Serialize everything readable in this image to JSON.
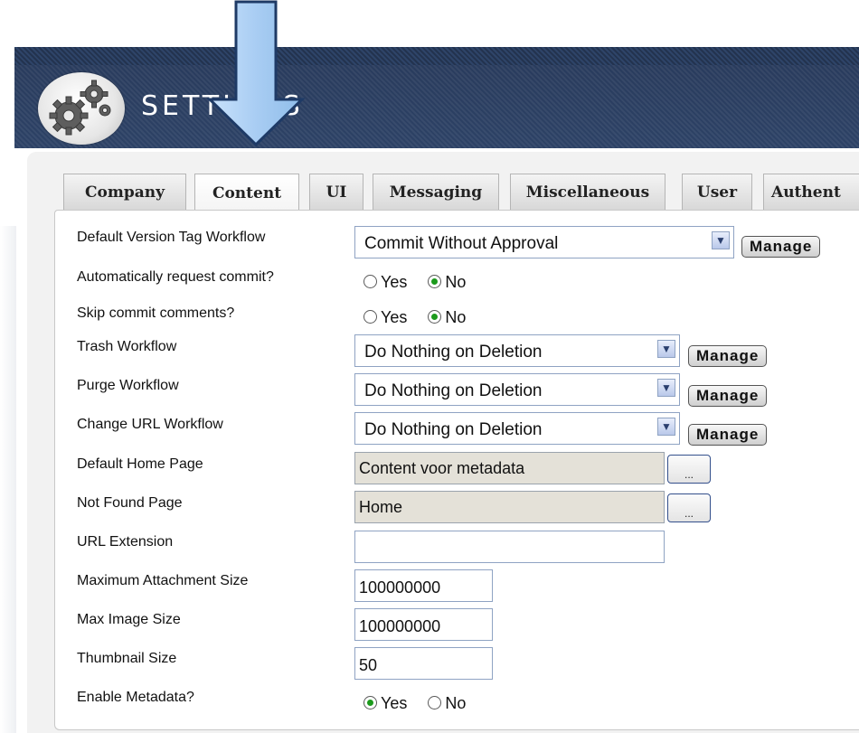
{
  "header": {
    "title": "SETTINGS"
  },
  "tabs": [
    {
      "label": "Company",
      "active": false
    },
    {
      "label": "Content",
      "active": true
    },
    {
      "label": "UI",
      "active": false
    },
    {
      "label": "Messaging",
      "active": false
    },
    {
      "label": "Miscellaneous",
      "active": false
    },
    {
      "label": "User",
      "active": false
    },
    {
      "label": "Authent",
      "active": false
    }
  ],
  "form": {
    "default_version_tag_workflow": {
      "label": "Default Version Tag Workflow",
      "value": "Commit Without Approval",
      "manage": "Manage"
    },
    "auto_request_commit": {
      "label": "Automatically request commit?",
      "yes": "Yes",
      "no": "No",
      "selected": "No"
    },
    "skip_commit_comments": {
      "label": "Skip commit comments?",
      "yes": "Yes",
      "no": "No",
      "selected": "No"
    },
    "trash_workflow": {
      "label": "Trash Workflow",
      "value": "Do Nothing on Deletion",
      "manage": "Manage"
    },
    "purge_workflow": {
      "label": "Purge Workflow",
      "value": "Do Nothing on Deletion",
      "manage": "Manage"
    },
    "change_url_workflow": {
      "label": "Change URL Workflow",
      "value": "Do Nothing on Deletion",
      "manage": "Manage"
    },
    "default_home_page": {
      "label": "Default Home Page",
      "value": "Content voor metadata",
      "browse": "..."
    },
    "not_found_page": {
      "label": "Not Found Page",
      "value": "Home",
      "browse": "..."
    },
    "url_extension": {
      "label": "URL Extension",
      "value": ""
    },
    "max_attachment_size": {
      "label": "Maximum Attachment Size",
      "value": "100000000"
    },
    "max_image_size": {
      "label": "Max Image Size",
      "value": "100000000"
    },
    "thumbnail_size": {
      "label": "Thumbnail Size",
      "value": "50"
    },
    "enable_metadata": {
      "label": "Enable Metadata?",
      "yes": "Yes",
      "no": "No",
      "selected": "Yes"
    }
  },
  "colors": {
    "header_bg": "#2d4266",
    "arrow_fill": "#a9cdf3",
    "radio_checked": "#1c9a1c",
    "readonly_bg": "#e4e1d8"
  },
  "icons": {
    "logo": "gears-icon",
    "select_arrow": "chevron-down-icon",
    "overlay": "arrow-down-icon"
  }
}
